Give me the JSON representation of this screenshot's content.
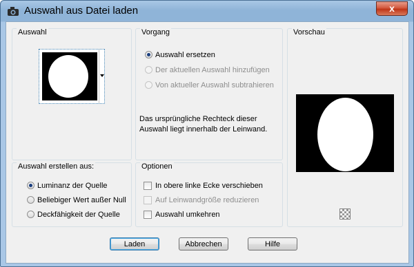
{
  "window": {
    "title": "Auswahl aus Datei laden",
    "close_glyph": "x"
  },
  "groups": {
    "auswahl": {
      "title": "Auswahl"
    },
    "vorgang": {
      "title": "Vorgang",
      "options": [
        {
          "label": "Auswahl ersetzen",
          "selected": true,
          "enabled": true
        },
        {
          "label": "Der aktuellen Auswahl hinzufügen",
          "selected": false,
          "enabled": false
        },
        {
          "label": "Von aktueller Auswahl subtrahieren",
          "selected": false,
          "enabled": false
        }
      ],
      "info_text": "Das ursprüngliche Rechteck dieser Auswahl liegt innerhalb der Leinwand."
    },
    "vorschau": {
      "title": "Vorschau"
    },
    "erstellen": {
      "title": "Auswahl erstellen aus:",
      "options": [
        {
          "label": "Luminanz der Quelle",
          "selected": true
        },
        {
          "label": "Beliebiger Wert außer Null",
          "selected": false
        },
        {
          "label": "Deckfähigkeit der Quelle",
          "selected": false
        }
      ]
    },
    "optionen": {
      "title": "Optionen",
      "checks": [
        {
          "label": "In obere linke Ecke verschieben",
          "checked": false,
          "enabled": true
        },
        {
          "label": "Auf Leinwandgröße reduzieren",
          "checked": false,
          "enabled": false
        },
        {
          "label": "Auswahl umkehren",
          "checked": false,
          "enabled": true
        }
      ]
    }
  },
  "buttons": {
    "ok": "Laden",
    "cancel": "Abbrechen",
    "help": "Hilfe"
  },
  "icons": {
    "title": "camera-icon",
    "dropdown": "chevron-down-icon",
    "transparency": "checkerboard-icon"
  },
  "colors": {
    "titlebar": "#8fb4d8",
    "close": "#c8462a",
    "radio_selected": "#1a3e7e",
    "default_button": "#3c7fb1"
  }
}
